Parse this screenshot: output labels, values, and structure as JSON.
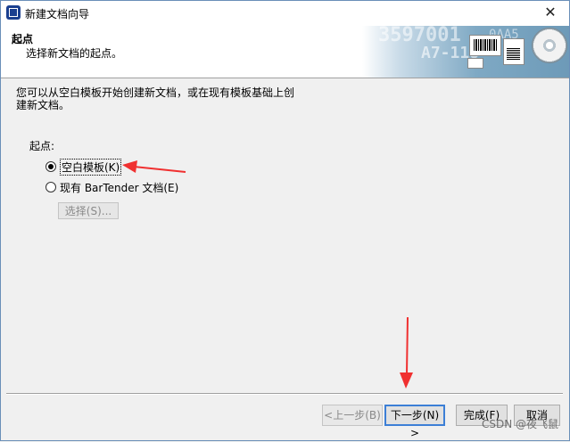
{
  "window": {
    "title": "新建文档向导",
    "close_glyph": "✕"
  },
  "header": {
    "title": "起点",
    "subtitle": "选择新文档的起点。",
    "banner_text1": "3597001",
    "banner_text2": "A7-118",
    "banner_text3": "0AA5"
  },
  "body": {
    "intro_line1": "您可以从空白模板开始创建新文档，或在现有模板基础上创",
    "intro_line2": "建新文档。",
    "start_label": "起点:",
    "options": [
      {
        "label": "空白模板(K)",
        "selected": true
      },
      {
        "label": "现有 BarTender 文档(E)",
        "selected": false
      }
    ],
    "select_button": "选择(S)..."
  },
  "footer": {
    "back": "<上一步(B)",
    "next": "下一步(N) >",
    "finish": "完成(F)",
    "cancel": "取消"
  },
  "annotations": {
    "arrow_color": "#f03030"
  },
  "watermark": "CSDN @夜飞鼠"
}
